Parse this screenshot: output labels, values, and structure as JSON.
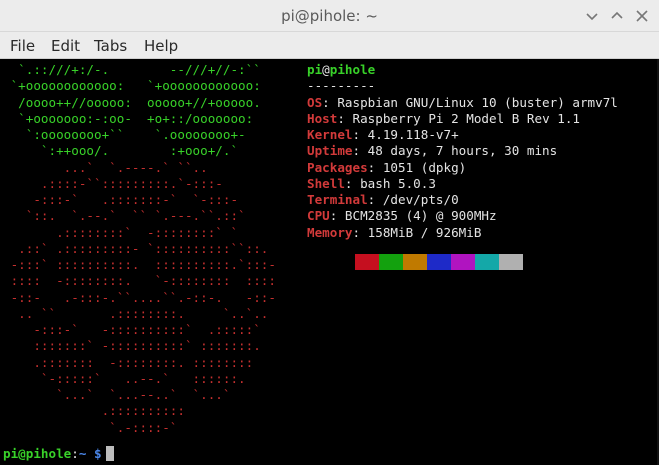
{
  "window": {
    "title": "pi@pihole: ~"
  },
  "menu": [
    "File",
    "Edit",
    "Tabs",
    "Help"
  ],
  "art": {
    "green": [
      "  `.::///+:/-.        --///+//-:``",
      " `+oooooooooooo:   `+oooooooooooo:",
      "  /oooo++//ooooo:  ooooo+//+ooooo.",
      "  `+ooooooo:-:oo-  +o+::/ooooooo:",
      "   `:oooooooo+``    `.oooooooo+-",
      "     `:++ooo/.        :+ooo+/.`"
    ],
    "red": [
      "        ...`  `.----.` ``..",
      "     .::::-``:::::::::.`-:::-",
      "    -:::-`   .:::::::-`  `-:::-",
      "   `::.  `.--.`  `` `.---.``.::`",
      "       .::::::::`  -::::::::` `",
      "  .::` .:::::::::- `::::::::::``::.",
      " -:::` ::::::::::.  ::::::::::.`:::-",
      " ::::  -::::::::.   `-::::::::  ::::",
      " -::-   .-:::-.``....``.-::-.   -::-",
      "  .. ``       .::::::::.     `..`..",
      "    -:::-`   -::::::::::`  .:::::`",
      "    :::::::` -::::::::::` :::::::.",
      "    .:::::::  -::::::::. ::::::::",
      "     `-:::::`   ..--.`   ::::::.",
      "       `...`  `...--..`  `...`",
      "             .::::::::::",
      "              `.-::::-`"
    ]
  },
  "info": {
    "user": "pi",
    "at": "@",
    "host": "pihole",
    "separator": "---------",
    "fields": [
      {
        "label": "OS",
        "value": "Raspbian GNU/Linux 10 (buster) armv7l"
      },
      {
        "label": "Host",
        "value": "Raspberry Pi 2 Model B Rev 1.1"
      },
      {
        "label": "Kernel",
        "value": "4.19.118-v7+"
      },
      {
        "label": "Uptime",
        "value": "48 days, 7 hours, 30 mins"
      },
      {
        "label": "Packages",
        "value": "1051 (dpkg)"
      },
      {
        "label": "Shell",
        "value": "bash 5.0.3"
      },
      {
        "label": "Terminal",
        "value": "/dev/pts/0"
      },
      {
        "label": "CPU",
        "value": "BCM2835 (4) @ 900MHz"
      },
      {
        "label": "Memory",
        "value": "158MiB / 926MiB"
      }
    ]
  },
  "palette": [
    "#000000",
    "#c50f1f",
    "#13a10e",
    "#c07a00",
    "#1e2ac8",
    "#b014c0",
    "#14a8a8",
    "#b0b0b0"
  ],
  "prompt": {
    "host": "pi@pihole",
    "colon": ":",
    "dir": "~",
    "symbol": " $"
  }
}
